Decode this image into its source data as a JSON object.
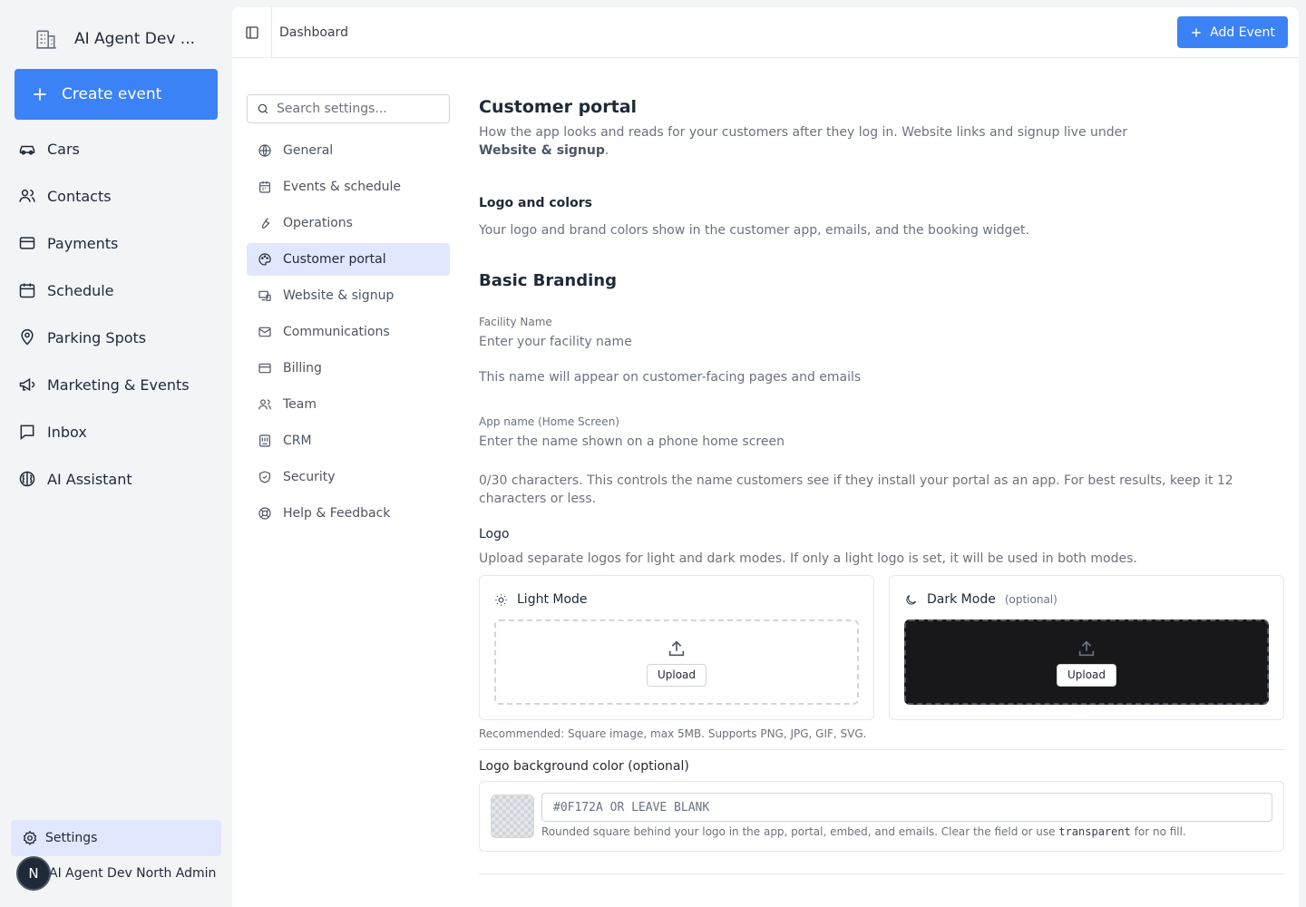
{
  "sidebar": {
    "brand": "AI Agent Dev ...",
    "create_label": "Create event",
    "items": [
      {
        "label": "Cars",
        "icon": "car-icon"
      },
      {
        "label": "Contacts",
        "icon": "users-icon"
      },
      {
        "label": "Payments",
        "icon": "credit-card-icon"
      },
      {
        "label": "Schedule",
        "icon": "calendar-icon"
      },
      {
        "label": "Parking Spots",
        "icon": "map-pin-icon"
      },
      {
        "label": "Marketing & Events",
        "icon": "megaphone-icon"
      },
      {
        "label": "Inbox",
        "icon": "message-icon"
      },
      {
        "label": "AI Assistant",
        "icon": "brain-icon"
      }
    ],
    "settings_label": "Settings",
    "user_initial": "N",
    "user_name": "AI Agent Dev North Admin"
  },
  "topbar": {
    "breadcrumb": "Dashboard",
    "add_label": "Add Event"
  },
  "settings_nav": {
    "search_placeholder": "Search settings...",
    "items": [
      {
        "label": "General",
        "icon": "globe-icon"
      },
      {
        "label": "Events & schedule",
        "icon": "calendar-icon"
      },
      {
        "label": "Operations",
        "icon": "wrench-icon"
      },
      {
        "label": "Customer portal",
        "icon": "palette-icon",
        "active": true
      },
      {
        "label": "Website & signup",
        "icon": "devices-icon"
      },
      {
        "label": "Communications",
        "icon": "mail-icon"
      },
      {
        "label": "Billing",
        "icon": "credit-card-icon"
      },
      {
        "label": "Team",
        "icon": "users-icon"
      },
      {
        "label": "CRM",
        "icon": "crm-icon"
      },
      {
        "label": "Security",
        "icon": "shield-icon"
      },
      {
        "label": "Help & Feedback",
        "icon": "lifebuoy-icon"
      }
    ]
  },
  "content": {
    "title": "Customer portal",
    "desc_prefix": "How the app looks and reads for your customers after they log in. Website links and signup live under ",
    "desc_bold": "Website & signup",
    "desc_suffix": ".",
    "logo_colors_title": "Logo and colors",
    "logo_colors_desc": "Your logo and brand colors show in the customer app, emails, and the booking widget.",
    "basic_branding": "Basic Branding",
    "facility_label": "Facility Name",
    "facility_placeholder": "Enter your facility name",
    "facility_hint": "This name will appear on customer-facing pages and emails",
    "app_name_label": "App name (Home Screen)",
    "app_name_placeholder": "Enter the name shown on a phone home screen",
    "app_name_hint": "0/30 characters. This controls the name customers see if they install your portal as an app. For best results, keep it 12 characters or less.",
    "logo_label": "Logo",
    "logo_desc": "Upload separate logos for light and dark modes. If only a light logo is set, it will be used in both modes.",
    "light_mode": "Light Mode",
    "dark_mode": "Dark Mode",
    "optional": "(optional)",
    "upload": "Upload",
    "recommended": "Recommended: Square image, max 5MB. Supports PNG, JPG, GIF, SVG.",
    "bg_color_label": "Logo background color (optional)",
    "bg_color_placeholder": "#0F172A OR LEAVE BLANK",
    "bg_hint_prefix": "Rounded square behind your logo in the app, portal, embed, and emails. Clear the field or use ",
    "bg_hint_code": "transparent",
    "bg_hint_suffix": " for no fill."
  },
  "colors": {
    "accent": "#3b82f6",
    "active_bg": "#e0e7ff",
    "dark_drop": "#18181b"
  }
}
